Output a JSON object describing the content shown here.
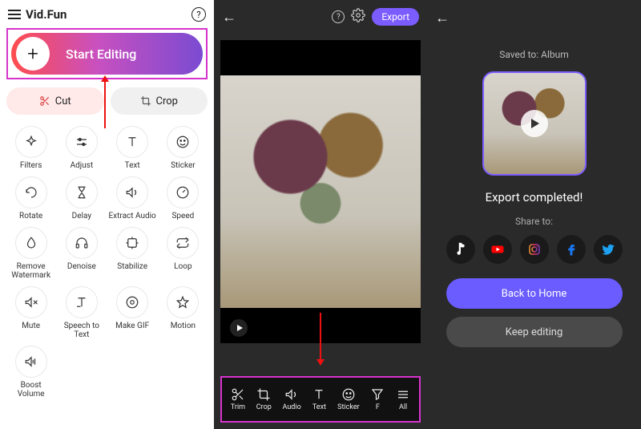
{
  "panel1": {
    "app_name": "Vid.Fun",
    "start_label": "Start Editing",
    "cut_label": "Cut",
    "crop_label": "Crop",
    "tools": [
      {
        "label": "Filters",
        "icon": "sparkle"
      },
      {
        "label": "Adjust",
        "icon": "sliders"
      },
      {
        "label": "Text",
        "icon": "text"
      },
      {
        "label": "Sticker",
        "icon": "smile"
      },
      {
        "label": "Rotate",
        "icon": "rotate"
      },
      {
        "label": "Delay",
        "icon": "hourglass"
      },
      {
        "label": "Extract Audio",
        "icon": "audio"
      },
      {
        "label": "Speed",
        "icon": "speed"
      },
      {
        "label": "Remove Watermark",
        "icon": "drop"
      },
      {
        "label": "Denoise",
        "icon": "headphones"
      },
      {
        "label": "Stabilize",
        "icon": "stabilize"
      },
      {
        "label": "Loop",
        "icon": "loop"
      },
      {
        "label": "Mute",
        "icon": "mute"
      },
      {
        "label": "Speech to Text",
        "icon": "stt"
      },
      {
        "label": "Make GIF",
        "icon": "gif"
      },
      {
        "label": "Motion",
        "icon": "star"
      },
      {
        "label": "Boost Volume",
        "icon": "boost"
      }
    ]
  },
  "panel2": {
    "export_btn": "Export",
    "toolbar": [
      {
        "label": "Trim",
        "icon": "scissors"
      },
      {
        "label": "Crop",
        "icon": "crop"
      },
      {
        "label": "Audio",
        "icon": "audio"
      },
      {
        "label": "Text",
        "icon": "text"
      },
      {
        "label": "Sticker",
        "icon": "smile"
      },
      {
        "label": "F",
        "icon": "filter"
      },
      {
        "label": "All",
        "icon": "all"
      }
    ]
  },
  "panel3": {
    "saved_to": "Saved to: Album",
    "export_complete": "Export completed!",
    "share_to": "Share to:",
    "social": [
      "tiktok",
      "youtube",
      "instagram",
      "facebook",
      "twitter"
    ],
    "back_home": "Back to Home",
    "keep_editing": "Keep editing"
  }
}
